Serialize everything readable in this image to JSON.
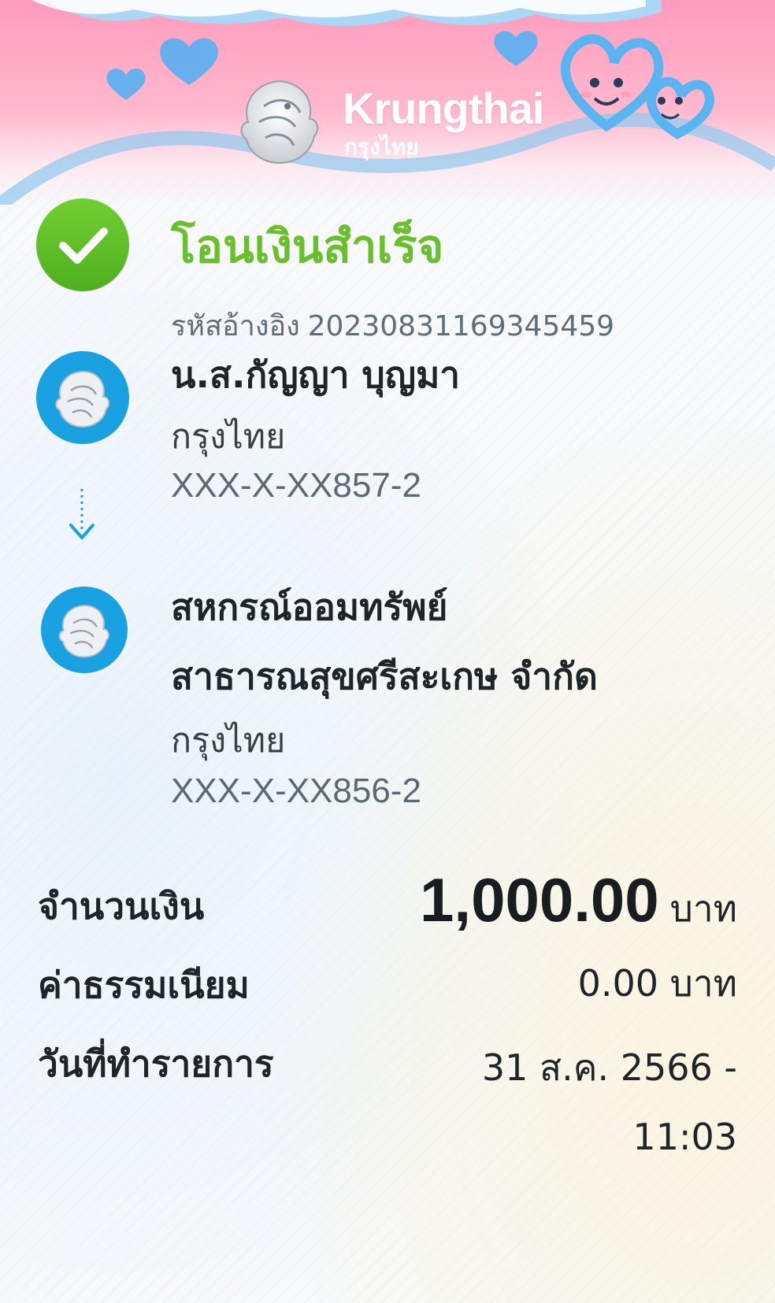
{
  "header": {
    "brand_name_en": "Krungthai",
    "brand_name_th": "กรุงไทย",
    "logo_icon": "krungthai-bird-logo-icon"
  },
  "status": {
    "title": "โอนเงินสำเร็จ",
    "icon": "check-icon",
    "reference_label": "รหัสอ้างอิง",
    "reference_value": "20230831169345459"
  },
  "sender": {
    "name": "น.ส.กัญญา บุญมา",
    "bank": "กรุงไทย",
    "account": "XXX-X-XX857-2"
  },
  "receiver": {
    "name_line1": "สหกรณ์ออมทรัพย์",
    "name_line2": "สาธารณสุขศรีสะเกษ จำกัด",
    "bank": "กรุงไทย",
    "account": "XXX-X-XX856-2"
  },
  "details": {
    "amount_label": "จำนวนเงิน",
    "amount_value": "1,000.00",
    "amount_unit": "บาท",
    "fee_label": "ค่าธรรมเนียม",
    "fee_value": "0.00 บาท",
    "date_label": "วันที่ทำรายการ",
    "date_value": "31 ส.ค. 2566 -",
    "time_value": "11:03"
  },
  "colors": {
    "success_green": "#6ac02c",
    "krungthai_blue": "#1aa1e1",
    "banner_pink": "#ff9bbd"
  }
}
